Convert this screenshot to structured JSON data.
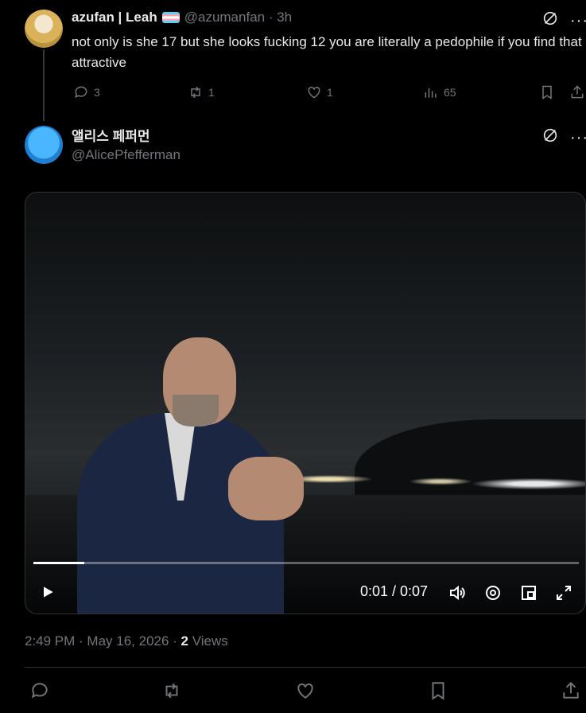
{
  "tweet1": {
    "name": "azufan | Leah",
    "handle": "@azumanfan · 3h",
    "text": "not only is she 17 but she looks fucking 12 you are literally a pedophile if you find that attractive",
    "replies": "3",
    "retweets": "1",
    "likes": "1",
    "views": "65"
  },
  "tweet2": {
    "name": "앨리스 페퍼먼",
    "handle": "@AlicePfefferman",
    "video": {
      "time_display": "0:01 / 0:07",
      "progress_fraction": 0.094
    },
    "timestamp": "2:49 PM · May 16, 2026 · ",
    "views_count": "2",
    "views_label": " Views"
  },
  "icons": {
    "more": "···"
  }
}
